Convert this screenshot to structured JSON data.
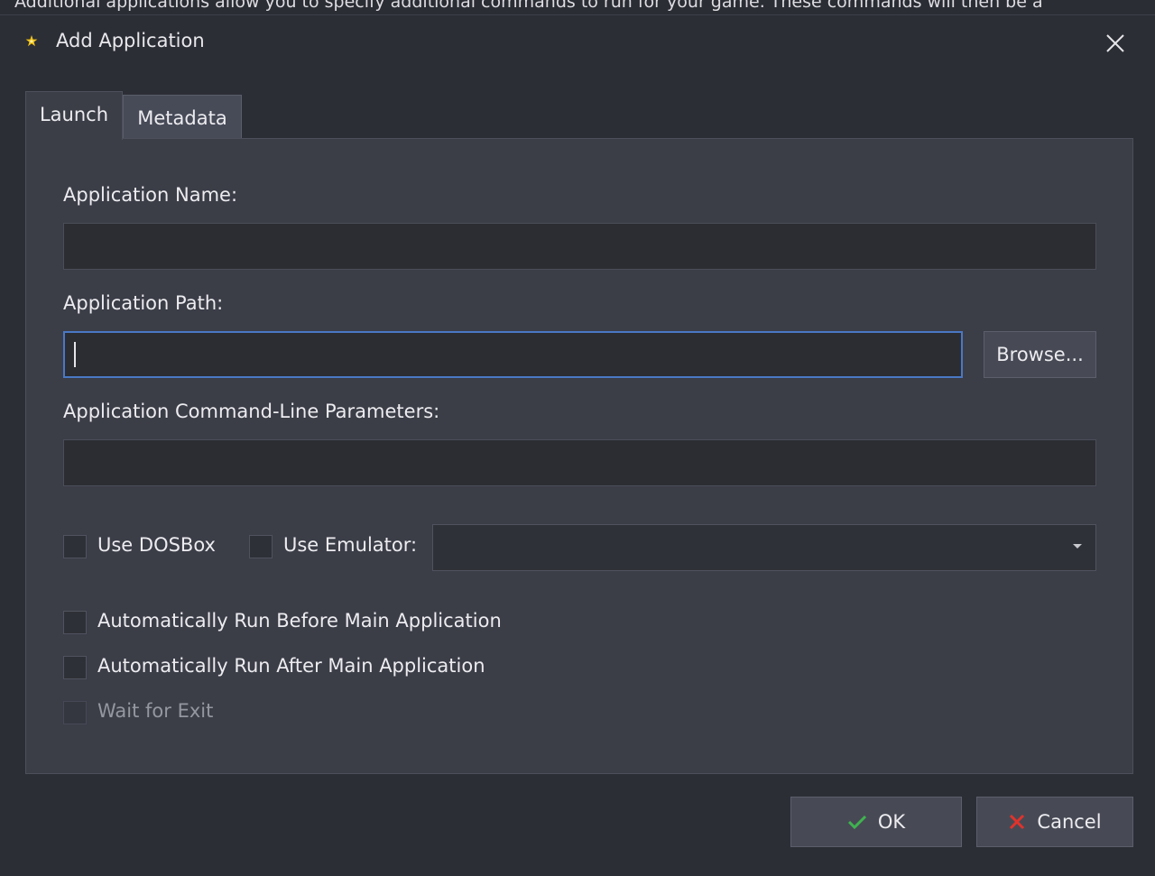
{
  "background": {
    "text": "Additional applications allow you to specify additional commands to run for your game.  These commands will then be a"
  },
  "window": {
    "title": "Add Application",
    "icon": "star-app-icon",
    "close_icon": "close-icon"
  },
  "tabs": [
    {
      "label": "Launch",
      "active": true
    },
    {
      "label": "Metadata",
      "active": false
    }
  ],
  "form": {
    "app_name_label": "Application Name:",
    "app_name_value": "",
    "app_path_label": "Application Path:",
    "app_path_value": "",
    "browse_label": "Browse...",
    "cmd_params_label": "Application Command-Line Parameters:",
    "cmd_params_value": "",
    "use_dosbox_label": "Use DOSBox",
    "use_dosbox_checked": false,
    "use_emulator_label": "Use Emulator:",
    "use_emulator_checked": false,
    "emulator_selected": "",
    "auto_before_label": "Automatically Run Before Main Application",
    "auto_before_checked": false,
    "auto_after_label": "Automatically Run After Main Application",
    "auto_after_checked": false,
    "wait_exit_label": "Wait for Exit",
    "wait_exit_checked": false,
    "wait_exit_enabled": false
  },
  "footer": {
    "ok_label": "OK",
    "ok_icon": "checkmark-icon",
    "cancel_label": "Cancel",
    "cancel_icon": "red-x-icon"
  },
  "colors": {
    "ok_check": "#3fb34f",
    "cancel_x": "#e0332b",
    "focus_border": "#4a78c4"
  }
}
